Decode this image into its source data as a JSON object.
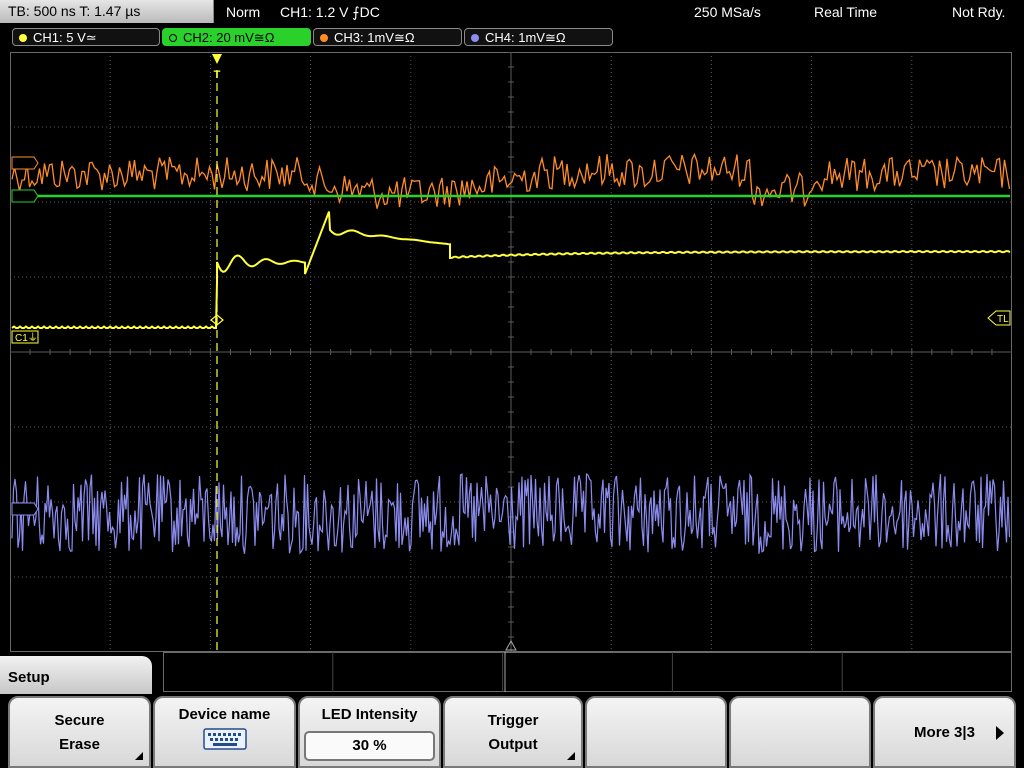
{
  "status": {
    "timebase": "TB: 500 ns   T: 1.47 µs",
    "trigger_mode": "Norm",
    "trigger_info": "CH1: 1.2 V ⨍DC",
    "sample_rate": "250 MSa/s",
    "acq_mode": "Real Time",
    "state": "Not Rdy."
  },
  "channels": [
    {
      "label": "CH1: 5 V≃",
      "color": "#ffff3c",
      "active": false
    },
    {
      "label": "CH2: 20 mV≅Ω",
      "color": "#29d12a",
      "active": true
    },
    {
      "label": "CH3: 1mV≅Ω",
      "color": "#ff8c28",
      "active": false
    },
    {
      "label": "CH4: 1mV≅Ω",
      "color": "#8c8cf0",
      "active": false
    }
  ],
  "markers": {
    "ch1_ground": "C1⏚",
    "trigger_level": "TL",
    "trigger_pos": "T"
  },
  "menu": {
    "title": "Setup",
    "keys": [
      {
        "line1": "Secure",
        "line2": "Erase"
      },
      {
        "line1": "Device name",
        "icon": "keyboard-icon"
      },
      {
        "line1": "LED Intensity",
        "value": "30 %"
      },
      {
        "line1": "Trigger",
        "line2": "Output"
      },
      {
        "line1": ""
      },
      {
        "line1": ""
      },
      {
        "line1": "More 3|3"
      }
    ]
  },
  "colors": {
    "grid": "#5a5a5a",
    "ch1": "#ffff3c",
    "ch2": "#29d12a",
    "ch3": "#ff8c28",
    "ch4": "#8c8cf0",
    "trigger": "#ffff3c"
  }
}
